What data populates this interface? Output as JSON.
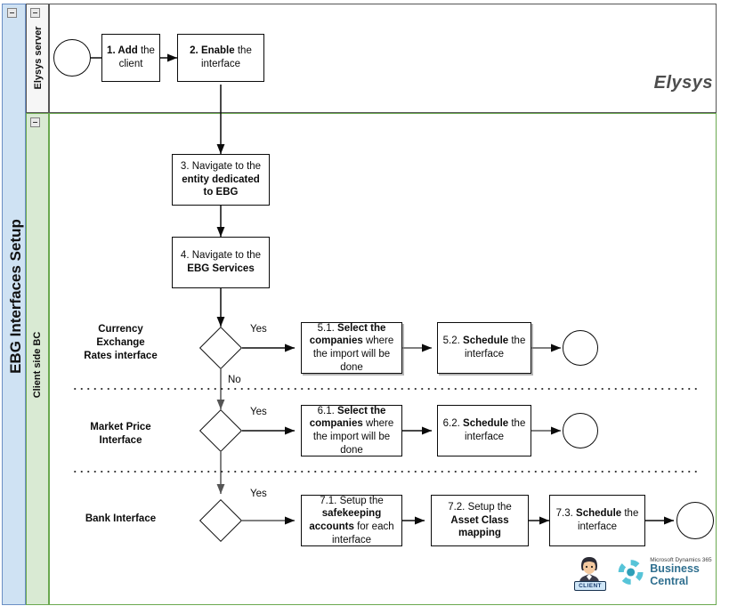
{
  "pool": {
    "title": "EBG Interfaces Setup",
    "color": "#cfe2f3"
  },
  "lanes": [
    {
      "id": "server",
      "title": "Elysys server",
      "color": "#f6f6f6"
    },
    {
      "id": "client",
      "title": "Client side BC",
      "color": "#d9ead3"
    }
  ],
  "brand": {
    "wordmark": "Elysys"
  },
  "row_labels": [
    {
      "id": "currency",
      "text": "Currency\nExchange\nRates interface"
    },
    {
      "id": "market",
      "text": "Market Price\nInterface"
    },
    {
      "id": "bank",
      "text": "Bank Interface"
    }
  ],
  "nodes": {
    "start": {
      "kind": "start-event",
      "label": ""
    },
    "step1": {
      "kind": "task",
      "num": "1. Add",
      "rest": " the client"
    },
    "step2": {
      "kind": "task",
      "num": "2. Enable",
      "rest": " the interface"
    },
    "step3": {
      "kind": "task",
      "pre": "3. Navigate to the ",
      "num": "entity dedicated to EBG",
      "rest": ""
    },
    "step4": {
      "kind": "task",
      "pre": "4. Navigate to the ",
      "num": "EBG Services",
      "rest": ""
    },
    "gw1": {
      "kind": "gateway",
      "label": ""
    },
    "gw2": {
      "kind": "gateway",
      "label": ""
    },
    "gw3": {
      "kind": "gateway",
      "label": ""
    },
    "step51": {
      "kind": "task",
      "pre": "5.1. ",
      "num": "Select the companies",
      "rest": " where the import will be done"
    },
    "step52": {
      "kind": "task",
      "pre": "5.2. ",
      "num": "Schedule",
      "rest": " the interface"
    },
    "end1": {
      "kind": "end-event",
      "label": ""
    },
    "step61": {
      "kind": "task",
      "pre": "6.1. ",
      "num": "Select the companies",
      "rest": " where the import will be done"
    },
    "step62": {
      "kind": "task",
      "pre": "6.2. ",
      "num": "Schedule",
      "rest": " the interface"
    },
    "end2": {
      "kind": "end-event",
      "label": ""
    },
    "step71": {
      "kind": "task",
      "pre": "7.1. Setup the ",
      "num": "safekeeping accounts",
      "rest": " for each interface"
    },
    "step72": {
      "kind": "task",
      "pre": "7.2. Setup the ",
      "num": "Asset Class mapping",
      "rest": ""
    },
    "step73": {
      "kind": "task",
      "pre": "7.3. ",
      "num": "Schedule",
      "rest": " the interface"
    },
    "end3": {
      "kind": "end-event",
      "label": ""
    }
  },
  "flow_labels": {
    "yes1": "Yes",
    "no1": "No",
    "yes2": "Yes",
    "yes3": "Yes"
  },
  "footer": {
    "client_badge": "CLIENT",
    "bc_line1": "Microsoft Dynamics 365",
    "bc_line2": "Business Central"
  }
}
